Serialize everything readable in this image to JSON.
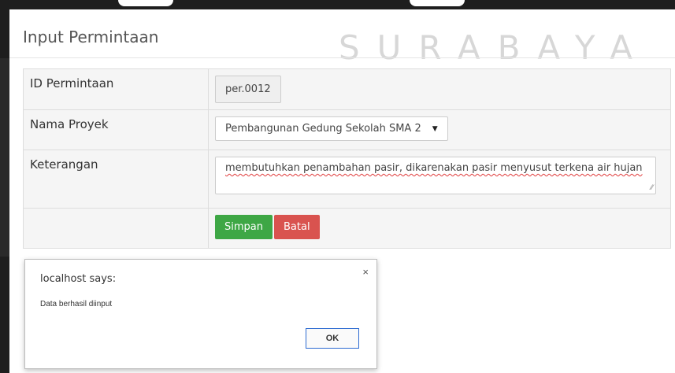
{
  "watermark": "SURABAYA",
  "page_title": "Input Permintaan",
  "form": {
    "rows": [
      {
        "label": "ID Permintaan",
        "value": "per.0012"
      },
      {
        "label": "Nama Proyek",
        "value": "Pembangunan Gedung Sekolah SMA 2"
      },
      {
        "label": "Keterangan",
        "value": "membutuhkan penambahan pasir, dikarenakan pasir menyusut terkena air hujan"
      }
    ],
    "save_label": "Simpan",
    "cancel_label": "Batal"
  },
  "dialog": {
    "title": "localhost says:",
    "message": "Data berhasil diinput",
    "close_glyph": "×",
    "ok_label": "OK"
  },
  "colors": {
    "save_button": "#3ea745",
    "cancel_button": "#d9534f",
    "dialog_ok_border": "#2d6bd1"
  }
}
